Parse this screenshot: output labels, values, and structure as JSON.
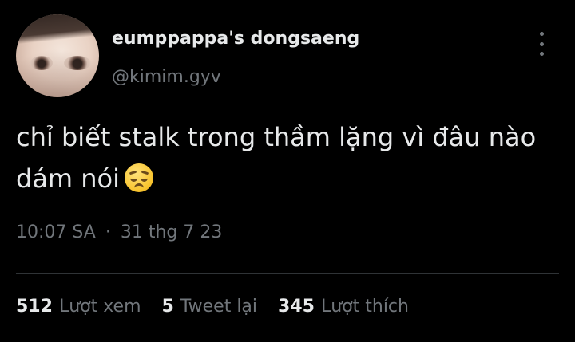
{
  "author": {
    "display_name": "eumppappa's dongsaeng",
    "handle": "@kimim.gyv"
  },
  "tweet": {
    "text": "chỉ biết stalk trong thầm lặng vì đâu nào dám nói",
    "emoji_icon": "pensive-face-icon"
  },
  "meta": {
    "time": "10:07 SA",
    "separator": "·",
    "date": "31 thg 7 23"
  },
  "stats": [
    {
      "count": "512",
      "label": "Lượt xem"
    },
    {
      "count": "5",
      "label": "Tweet lại"
    },
    {
      "count": "345",
      "label": "Lượt thích"
    }
  ],
  "colors": {
    "background": "#000000",
    "primary_text": "#e7e9ea",
    "secondary_text": "#71767b",
    "divider": "#2f3336"
  }
}
